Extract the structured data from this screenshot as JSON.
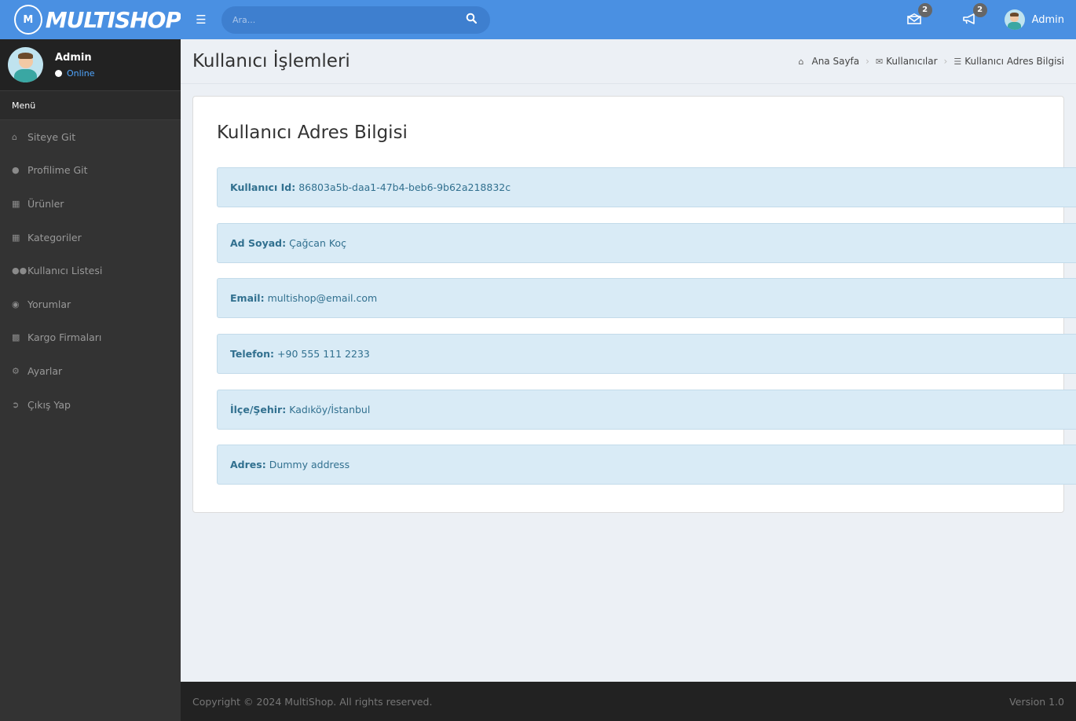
{
  "brand": {
    "logo_text": "MULTISHOP",
    "badge_text": "M"
  },
  "topbar": {
    "search_placeholder": "Ara...",
    "messages_count": "2",
    "announcements_count": "2",
    "user_name": "Admin"
  },
  "sidebar": {
    "user_name": "Admin",
    "user_status": "Online",
    "menu_header": "Menü",
    "items": [
      {
        "label": "Siteye Git",
        "icon": "home-icon"
      },
      {
        "label": "Profilime Git",
        "icon": "user-icon"
      },
      {
        "label": "Ürünler",
        "icon": "grid-icon"
      },
      {
        "label": "Kategoriler",
        "icon": "grid-icon"
      },
      {
        "label": "Kullanıcı Listesi",
        "icon": "users-icon"
      },
      {
        "label": "Yorumlar",
        "icon": "comments-icon"
      },
      {
        "label": "Kargo Firmaları",
        "icon": "truck-icon"
      },
      {
        "label": "Ayarlar",
        "icon": "gear-icon"
      },
      {
        "label": "Çıkış Yap",
        "icon": "sign-out-icon"
      }
    ]
  },
  "page": {
    "title": "Kullanıcı İşlemleri",
    "breadcrumb": [
      "Ana Sayfa",
      "Kullanıcılar",
      "Kullanıcı Adres Bilgisi"
    ]
  },
  "card": {
    "title": "Kullanıcı Adres Bilgisi",
    "rows": [
      {
        "label": "Kullanıcı Id:",
        "value": "86803a5b-daa1-47b4-beb6-9b62a218832c"
      },
      {
        "label": "Ad Soyad:",
        "value": "Çağcan Koç"
      },
      {
        "label": "Email:",
        "value": "multishop@email.com"
      },
      {
        "label": "Telefon:",
        "value": "+90 555 111 2233"
      },
      {
        "label": "İlçe/Şehir:",
        "value": "Kadıköy/İstanbul"
      },
      {
        "label": "Adres:",
        "value": "Dummy address"
      }
    ]
  },
  "footer": {
    "copyright": "Copyright © 2024 MultiShop. All rights reserved.",
    "version": "Version 1.0"
  },
  "colors": {
    "primary": "#4a90e2",
    "sidebar": "#333333",
    "info_bg": "#d9ebf6",
    "info_text": "#31708f"
  }
}
